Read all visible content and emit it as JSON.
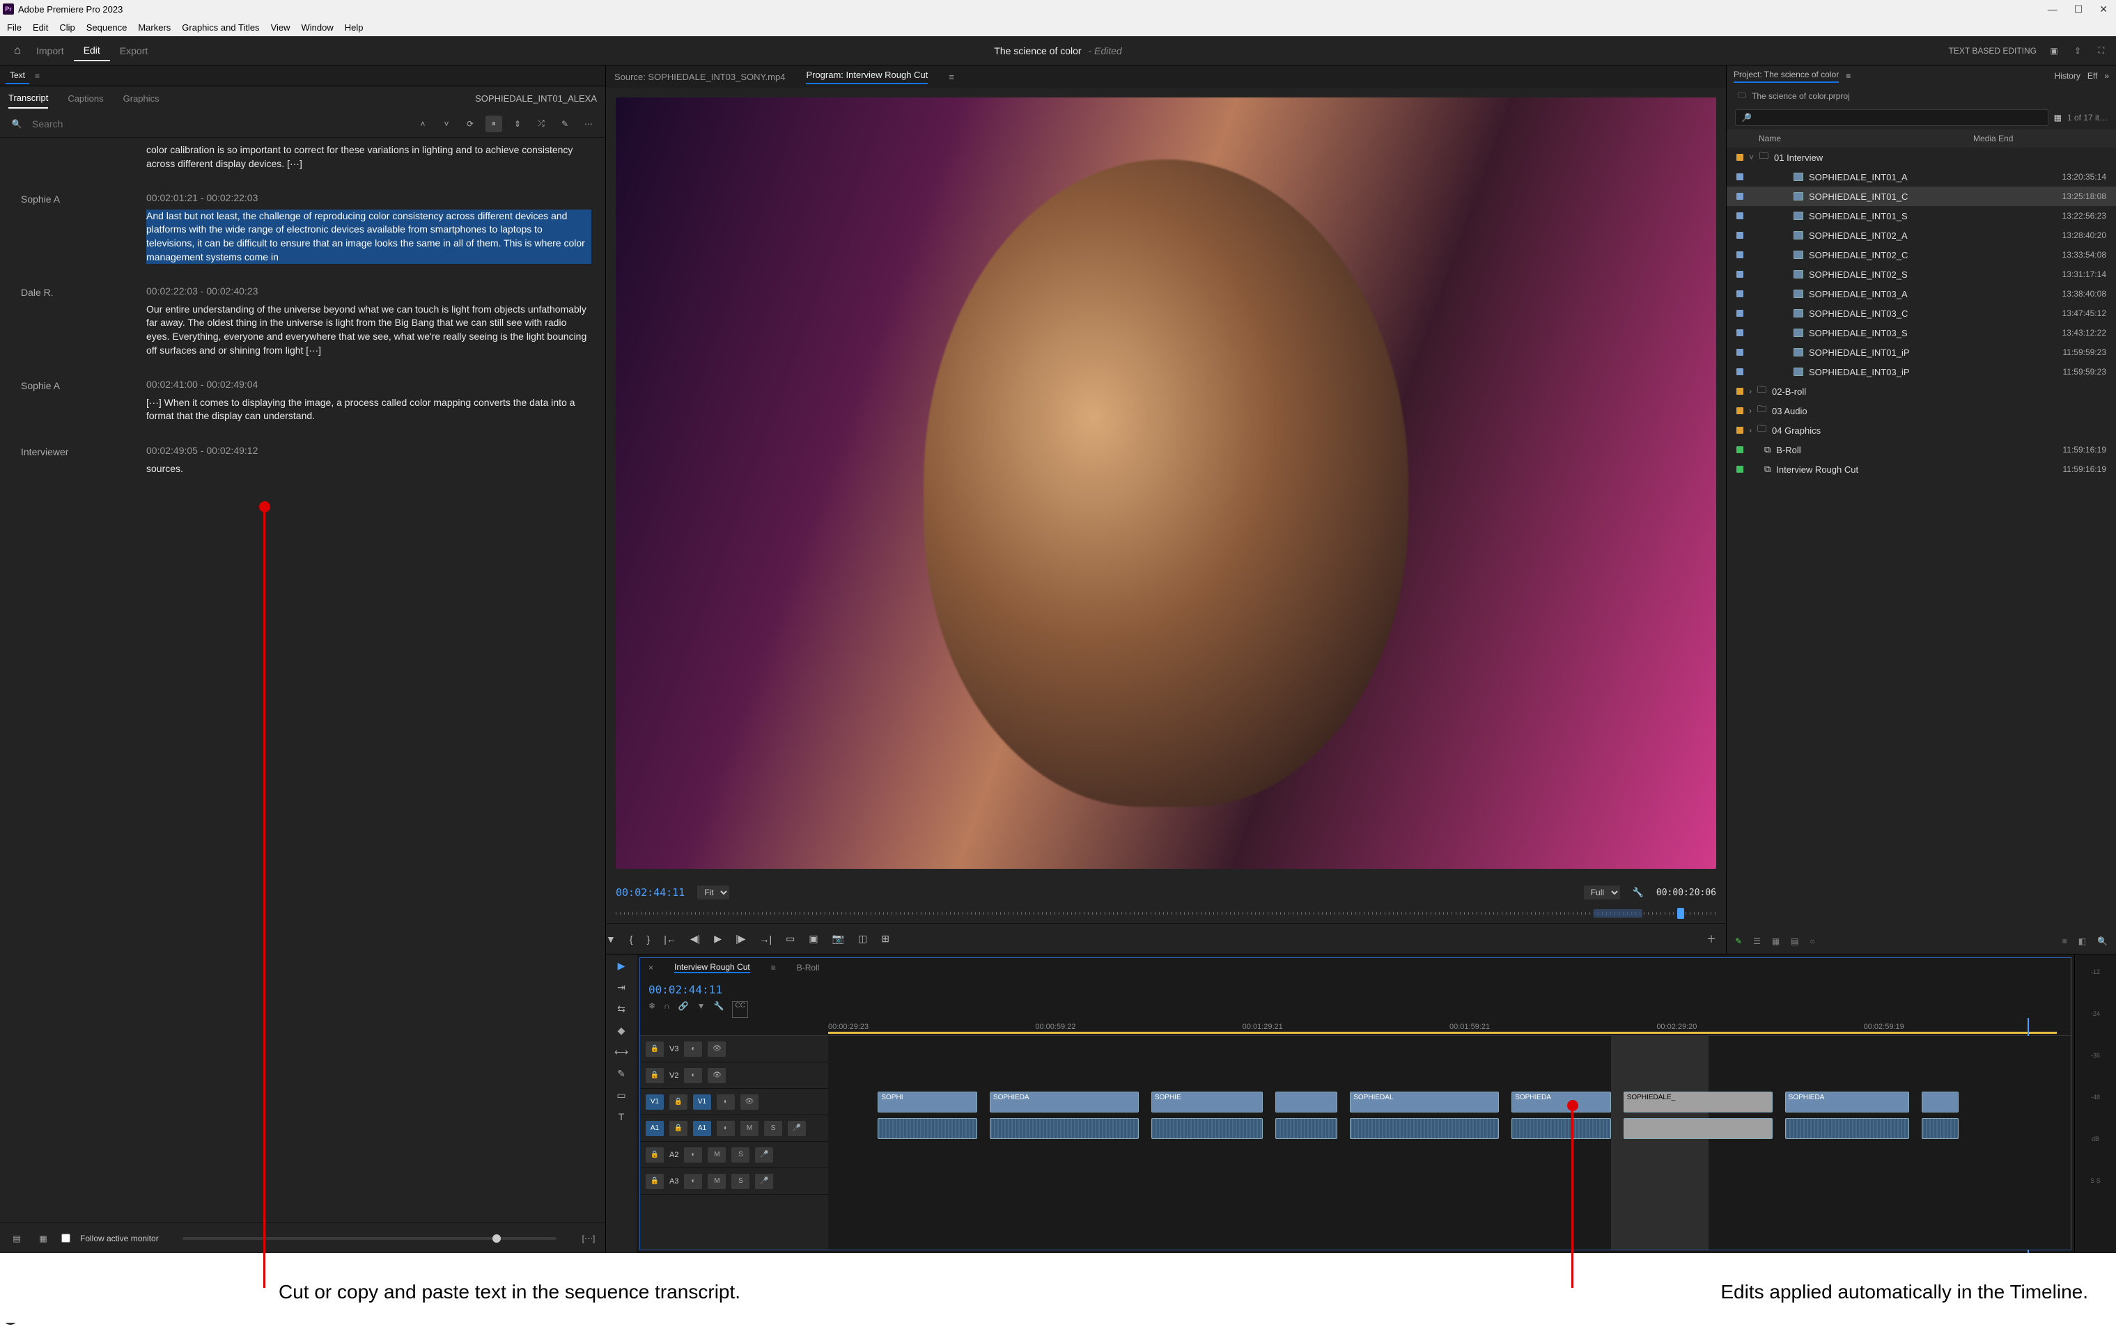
{
  "app": {
    "title": "Adobe Premiere Pro 2023"
  },
  "menu": [
    "File",
    "Edit",
    "Clip",
    "Sequence",
    "Markers",
    "Graphics and Titles",
    "View",
    "Window",
    "Help"
  ],
  "workspace": {
    "tabs": [
      "Import",
      "Edit",
      "Export"
    ],
    "active": "Edit",
    "project_title": "The science of color",
    "status": "- Edited",
    "text_based": "TEXT BASED EDITING"
  },
  "text_panel": {
    "panel_label": "Text",
    "sub_tabs": [
      "Transcript",
      "Captions",
      "Graphics"
    ],
    "clip_name": "SOPHIEDALE_INT01_ALEXA",
    "search_placeholder": "Search",
    "follow": "Follow active monitor",
    "segments": [
      {
        "speaker": "",
        "tc": "",
        "text": "color calibration is so important to correct for these variations in lighting and to achieve consistency across different display devices. [···]",
        "selected": false
      },
      {
        "speaker": "Sophie A",
        "tc": "00:02:01:21 - 00:02:22:03",
        "text": "And last but not least, the challenge of reproducing color consistency across different devices and platforms with the wide range of electronic devices available from smartphones to laptops to televisions, it can be difficult to ensure that an image looks the same in all of them. This is where color management systems come in",
        "selected": true
      },
      {
        "speaker": "Dale R.",
        "tc": "00:02:22:03 - 00:02:40:23",
        "text": "Our entire understanding of the universe beyond what we can touch is light from objects unfathomably far away. The oldest thing in the universe is light from the Big Bang that we can still see with radio eyes. Everything, everyone and everywhere that we see, what we're really seeing is the light bouncing off surfaces and or shining from light [···]",
        "selected": false
      },
      {
        "speaker": "Sophie A",
        "tc": "00:02:41:00 - 00:02:49:04",
        "text": "[···] When it comes to displaying the image, a process called color mapping converts the data into a format that the display can understand.",
        "selected": false
      },
      {
        "speaker": "Interviewer",
        "tc": "00:02:49:05 - 00:02:49:12",
        "text": "sources.",
        "selected": false
      }
    ]
  },
  "program": {
    "source_tab": "Source: SOPHIEDALE_INT03_SONY.mp4",
    "program_tab": "Program: Interview Rough Cut",
    "tc_left": "00:02:44:11",
    "fit": "Fit",
    "full": "Full",
    "tc_right": "00:00:20:06"
  },
  "project_panel": {
    "title": "Project:  The science of color",
    "history": "History",
    "eff": "Eff",
    "file": "The science of color.prproj",
    "count": "1 of 17 it…",
    "cols": {
      "name": "Name",
      "media_end": "Media End"
    },
    "folders": {
      "interview": "01 Interview",
      "broll": "02-B-roll",
      "audio": "03 Audio",
      "graphics": "04 Graphics"
    },
    "clips": [
      {
        "name": "SOPHIEDALE_INT01_A",
        "tc": "13:20:35:14",
        "sel": false
      },
      {
        "name": "SOPHIEDALE_INT01_C",
        "tc": "13:25:18:08",
        "sel": true
      },
      {
        "name": "SOPHIEDALE_INT01_S",
        "tc": "13:22:56:23",
        "sel": false
      },
      {
        "name": "SOPHIEDALE_INT02_A",
        "tc": "13:28:40:20",
        "sel": false
      },
      {
        "name": "SOPHIEDALE_INT02_C",
        "tc": "13:33:54:08",
        "sel": false
      },
      {
        "name": "SOPHIEDALE_INT02_S",
        "tc": "13:31:17:14",
        "sel": false
      },
      {
        "name": "SOPHIEDALE_INT03_A",
        "tc": "13:38:40:08",
        "sel": false
      },
      {
        "name": "SOPHIEDALE_INT03_C",
        "tc": "13:47:45:12",
        "sel": false
      },
      {
        "name": "SOPHIEDALE_INT03_S",
        "tc": "13:43:12:22",
        "sel": false
      },
      {
        "name": "SOPHIEDALE_INT01_iP",
        "tc": "11:59:59:23",
        "sel": false
      },
      {
        "name": "SOPHIEDALE_INT03_iP",
        "tc": "11:59:59:23",
        "sel": false
      }
    ],
    "sequences": [
      {
        "name": "B-Roll",
        "tc": "11:59:16:19"
      },
      {
        "name": "Interview Rough Cut",
        "tc": "11:59:16:19"
      }
    ]
  },
  "timeline": {
    "tab1": "Interview Rough Cut",
    "tab2": "B-Roll",
    "tc": "00:02:44:11",
    "ruler": [
      "00:00:29:23",
      "00:00:59:22",
      "00:01:29:21",
      "00:01:59:21",
      "00:02:29:20",
      "00:02:59:19"
    ],
    "tracks": {
      "v3": "V3",
      "v2": "V2",
      "v1": "V1",
      "a1": "A1",
      "a2": "A2",
      "a3": "A3"
    },
    "clip_labels": [
      "SOPHI",
      "SOPHIEDA",
      "SOPHIE",
      "SOPHIEDAL",
      "SOPHIEDA",
      "SOPHIEDALE_",
      "SOPHIEDA"
    ]
  },
  "meters": [
    "-12",
    "-24",
    "-36",
    "-48",
    "dB",
    "S   S"
  ],
  "annotations": {
    "left": "Cut or copy and paste text in the sequence transcript.",
    "right": "Edits applied automatically in the Timeline."
  },
  "colors": {
    "accent": "#1473e6",
    "tc_blue": "#4aa0ff",
    "highlight": "#1a4d87",
    "anno": "#d00000"
  }
}
